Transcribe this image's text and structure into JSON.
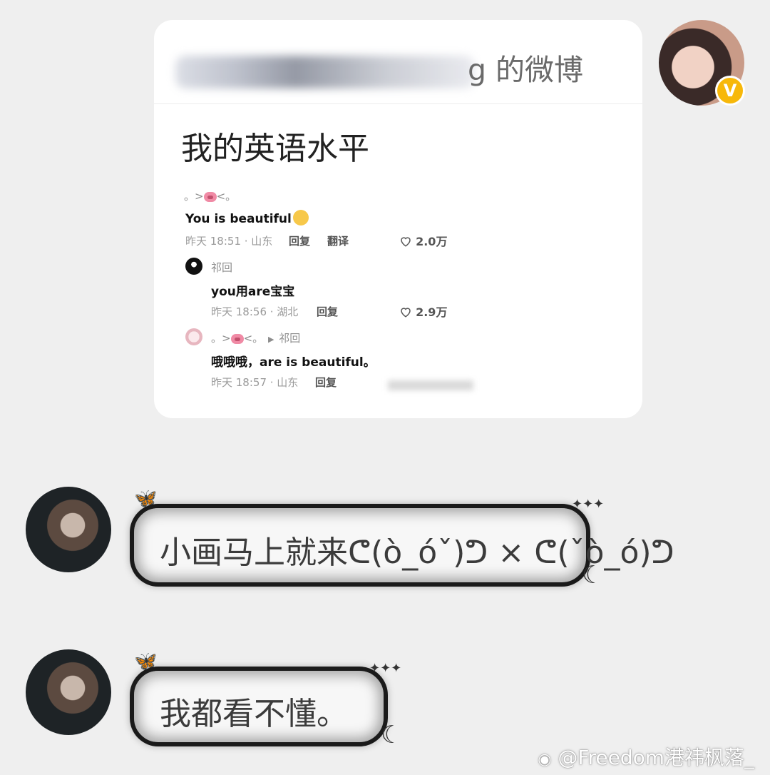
{
  "card": {
    "header_title_visible": "g 的微博",
    "post_title": "我的英语水平",
    "comment1": {
      "name": "。>",
      "name_suffix": "<。",
      "text": "You is beautiful",
      "meta": "昨天 18:51 · 山东",
      "reply": "回复",
      "translate": "翻译",
      "likes": "2.0万"
    },
    "reply1": {
      "name": "祁回",
      "text": "you用are宝宝",
      "meta": "昨天 18:56 · 湖北",
      "reply": "回复",
      "likes": "2.9万"
    },
    "reply2": {
      "name": "。>",
      "name_suffix": "<。",
      "arrow": "▶",
      "to": "祁回",
      "text": "哦哦哦，are is beautiful。",
      "meta": "昨天 18:57 · 山东",
      "reply": "回复"
    }
  },
  "messages": [
    {
      "text": "小画马上就来ᕦ(ò_óˇ)ᕤ × ᕦ(ˇò_ó)ᕤ"
    },
    {
      "text": "我都看不懂。"
    }
  ],
  "verified_badge": "V",
  "watermark": "@Freedom港祎枫落_",
  "decorations": {
    "sparkle": "✦✦✦",
    "moon": "☾",
    "butterfly": "🦋"
  }
}
